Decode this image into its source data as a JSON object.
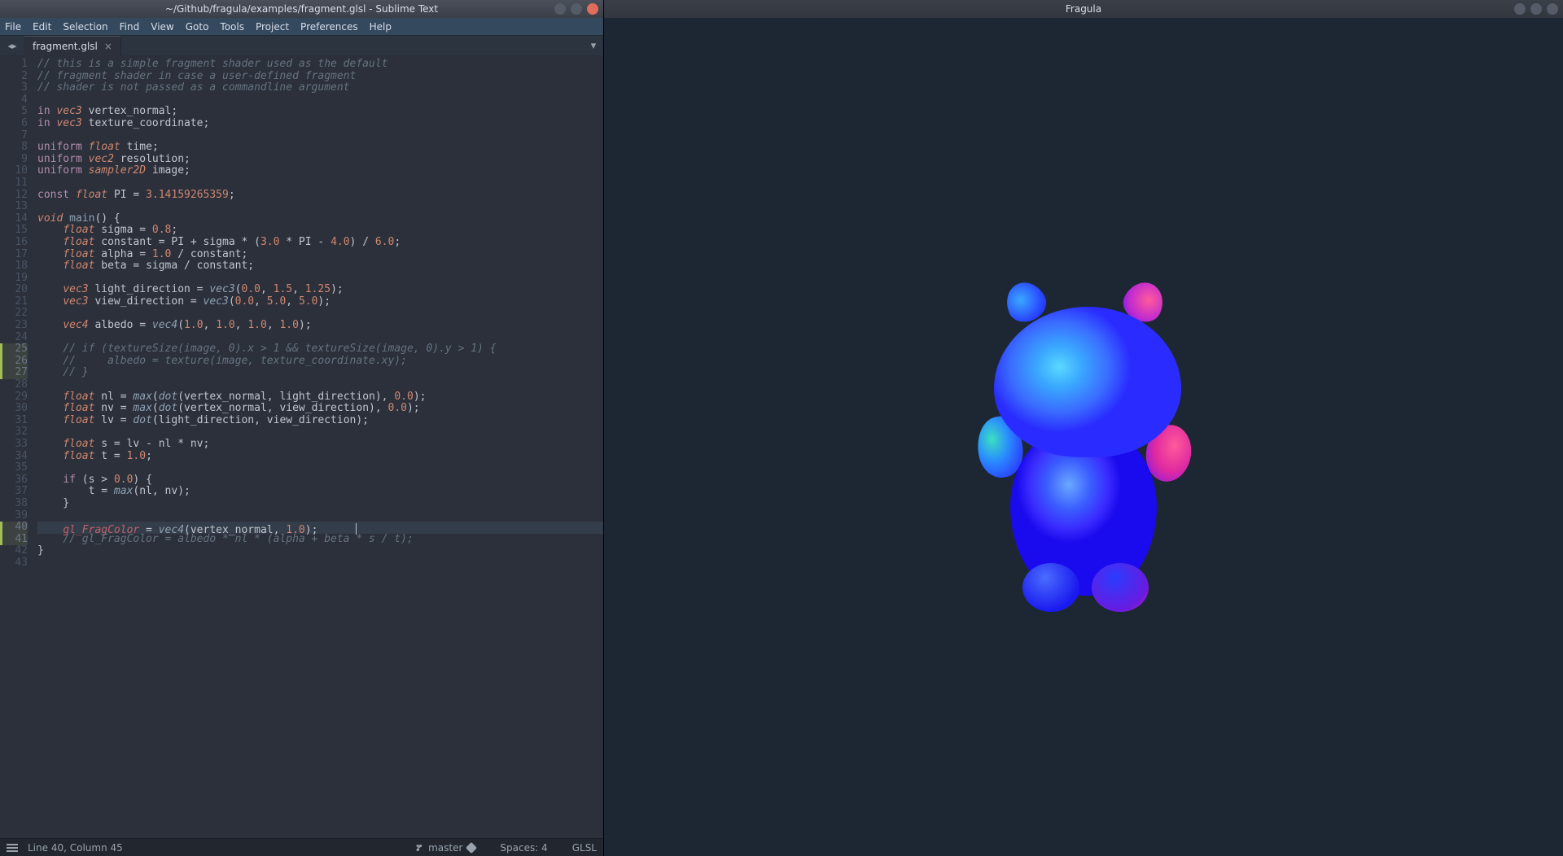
{
  "editor": {
    "title": "~/Github/fragula/examples/fragment.glsl - Sublime Text",
    "menu": [
      "File",
      "Edit",
      "Selection",
      "Find",
      "View",
      "Goto",
      "Tools",
      "Project",
      "Preferences",
      "Help"
    ],
    "tab_label": "fragment.glsl",
    "cursor_line": 40,
    "lines": [
      {
        "n": 1,
        "mod": false,
        "tokens": [
          [
            "c-comment",
            "// this is a simple fragment shader used as the default"
          ]
        ]
      },
      {
        "n": 2,
        "mod": false,
        "tokens": [
          [
            "c-comment",
            "// fragment shader in case a user-defined fragment"
          ]
        ]
      },
      {
        "n": 3,
        "mod": false,
        "tokens": [
          [
            "c-comment",
            "// shader is not passed as a commandline argument"
          ]
        ]
      },
      {
        "n": 4,
        "mod": false,
        "tokens": []
      },
      {
        "n": 5,
        "mod": false,
        "tokens": [
          [
            "c-kw",
            "in "
          ],
          [
            "c-type",
            "vec3 "
          ],
          [
            "c-ident",
            "vertex_normal;"
          ]
        ]
      },
      {
        "n": 6,
        "mod": false,
        "tokens": [
          [
            "c-kw",
            "in "
          ],
          [
            "c-type",
            "vec3 "
          ],
          [
            "c-ident",
            "texture_coordinate;"
          ]
        ]
      },
      {
        "n": 7,
        "mod": false,
        "tokens": []
      },
      {
        "n": 8,
        "mod": false,
        "tokens": [
          [
            "c-kw",
            "uniform "
          ],
          [
            "c-type",
            "float "
          ],
          [
            "c-ident",
            "time;"
          ]
        ]
      },
      {
        "n": 9,
        "mod": false,
        "tokens": [
          [
            "c-kw",
            "uniform "
          ],
          [
            "c-type",
            "vec2 "
          ],
          [
            "c-ident",
            "resolution;"
          ]
        ]
      },
      {
        "n": 10,
        "mod": false,
        "tokens": [
          [
            "c-kw",
            "uniform "
          ],
          [
            "c-type",
            "sampler2D "
          ],
          [
            "c-ident",
            "image;"
          ]
        ]
      },
      {
        "n": 11,
        "mod": false,
        "tokens": []
      },
      {
        "n": 12,
        "mod": false,
        "tokens": [
          [
            "c-kw",
            "const "
          ],
          [
            "c-type",
            "float "
          ],
          [
            "c-ident",
            "PI = "
          ],
          [
            "c-num",
            "3.14159265359"
          ],
          [
            "c-ident",
            ";"
          ]
        ]
      },
      {
        "n": 13,
        "mod": false,
        "tokens": []
      },
      {
        "n": 14,
        "mod": false,
        "tokens": [
          [
            "c-type",
            "void "
          ],
          [
            "c-func",
            "main"
          ],
          [
            "c-ident",
            "() {"
          ]
        ]
      },
      {
        "n": 15,
        "mod": false,
        "tokens": [
          [
            "c-ident",
            "    "
          ],
          [
            "c-type",
            "float "
          ],
          [
            "c-ident",
            "sigma = "
          ],
          [
            "c-num",
            "0.8"
          ],
          [
            "c-ident",
            ";"
          ]
        ]
      },
      {
        "n": 16,
        "mod": false,
        "tokens": [
          [
            "c-ident",
            "    "
          ],
          [
            "c-type",
            "float "
          ],
          [
            "c-ident",
            "constant = PI + sigma * ("
          ],
          [
            "c-num",
            "3.0"
          ],
          [
            "c-ident",
            " * PI - "
          ],
          [
            "c-num",
            "4.0"
          ],
          [
            "c-ident",
            ") / "
          ],
          [
            "c-num",
            "6.0"
          ],
          [
            "c-ident",
            ";"
          ]
        ]
      },
      {
        "n": 17,
        "mod": false,
        "tokens": [
          [
            "c-ident",
            "    "
          ],
          [
            "c-type",
            "float "
          ],
          [
            "c-ident",
            "alpha = "
          ],
          [
            "c-num",
            "1.0"
          ],
          [
            "c-ident",
            " / constant;"
          ]
        ]
      },
      {
        "n": 18,
        "mod": false,
        "tokens": [
          [
            "c-ident",
            "    "
          ],
          [
            "c-type",
            "float "
          ],
          [
            "c-ident",
            "beta = sigma / constant;"
          ]
        ]
      },
      {
        "n": 19,
        "mod": false,
        "tokens": []
      },
      {
        "n": 20,
        "mod": false,
        "tokens": [
          [
            "c-ident",
            "    "
          ],
          [
            "c-type",
            "vec3 "
          ],
          [
            "c-ident",
            "light_direction = "
          ],
          [
            "c-builtin",
            "vec3"
          ],
          [
            "c-ident",
            "("
          ],
          [
            "c-num",
            "0.0"
          ],
          [
            "c-ident",
            ", "
          ],
          [
            "c-num",
            "1.5"
          ],
          [
            "c-ident",
            ", "
          ],
          [
            "c-num",
            "1.25"
          ],
          [
            "c-ident",
            ");"
          ]
        ]
      },
      {
        "n": 21,
        "mod": false,
        "tokens": [
          [
            "c-ident",
            "    "
          ],
          [
            "c-type",
            "vec3 "
          ],
          [
            "c-ident",
            "view_direction = "
          ],
          [
            "c-builtin",
            "vec3"
          ],
          [
            "c-ident",
            "("
          ],
          [
            "c-num",
            "0.0"
          ],
          [
            "c-ident",
            ", "
          ],
          [
            "c-num",
            "5.0"
          ],
          [
            "c-ident",
            ", "
          ],
          [
            "c-num",
            "5.0"
          ],
          [
            "c-ident",
            ");"
          ]
        ]
      },
      {
        "n": 22,
        "mod": false,
        "tokens": []
      },
      {
        "n": 23,
        "mod": false,
        "tokens": [
          [
            "c-ident",
            "    "
          ],
          [
            "c-type",
            "vec4 "
          ],
          [
            "c-ident",
            "albedo = "
          ],
          [
            "c-builtin",
            "vec4"
          ],
          [
            "c-ident",
            "("
          ],
          [
            "c-num",
            "1.0"
          ],
          [
            "c-ident",
            ", "
          ],
          [
            "c-num",
            "1.0"
          ],
          [
            "c-ident",
            ", "
          ],
          [
            "c-num",
            "1.0"
          ],
          [
            "c-ident",
            ", "
          ],
          [
            "c-num",
            "1.0"
          ],
          [
            "c-ident",
            ");"
          ]
        ]
      },
      {
        "n": 24,
        "mod": false,
        "tokens": []
      },
      {
        "n": 25,
        "mod": true,
        "tokens": [
          [
            "c-ident",
            "    "
          ],
          [
            "c-comment",
            "// if (textureSize(image, 0).x > 1 && textureSize(image, 0).y > 1) {"
          ]
        ]
      },
      {
        "n": 26,
        "mod": true,
        "tokens": [
          [
            "c-ident",
            "    "
          ],
          [
            "c-comment",
            "//     albedo = texture(image, texture_coordinate.xy);"
          ]
        ]
      },
      {
        "n": 27,
        "mod": true,
        "tokens": [
          [
            "c-ident",
            "    "
          ],
          [
            "c-comment",
            "// }"
          ]
        ]
      },
      {
        "n": 28,
        "mod": false,
        "tokens": []
      },
      {
        "n": 29,
        "mod": false,
        "tokens": [
          [
            "c-ident",
            "    "
          ],
          [
            "c-type",
            "float "
          ],
          [
            "c-ident",
            "nl = "
          ],
          [
            "c-builtin",
            "max"
          ],
          [
            "c-ident",
            "("
          ],
          [
            "c-builtin",
            "dot"
          ],
          [
            "c-ident",
            "(vertex_normal, light_direction), "
          ],
          [
            "c-num",
            "0.0"
          ],
          [
            "c-ident",
            ");"
          ]
        ]
      },
      {
        "n": 30,
        "mod": false,
        "tokens": [
          [
            "c-ident",
            "    "
          ],
          [
            "c-type",
            "float "
          ],
          [
            "c-ident",
            "nv = "
          ],
          [
            "c-builtin",
            "max"
          ],
          [
            "c-ident",
            "("
          ],
          [
            "c-builtin",
            "dot"
          ],
          [
            "c-ident",
            "(vertex_normal, view_direction), "
          ],
          [
            "c-num",
            "0.0"
          ],
          [
            "c-ident",
            ");"
          ]
        ]
      },
      {
        "n": 31,
        "mod": false,
        "tokens": [
          [
            "c-ident",
            "    "
          ],
          [
            "c-type",
            "float "
          ],
          [
            "c-ident",
            "lv = "
          ],
          [
            "c-builtin",
            "dot"
          ],
          [
            "c-ident",
            "(light_direction, view_direction);"
          ]
        ]
      },
      {
        "n": 32,
        "mod": false,
        "tokens": []
      },
      {
        "n": 33,
        "mod": false,
        "tokens": [
          [
            "c-ident",
            "    "
          ],
          [
            "c-type",
            "float "
          ],
          [
            "c-ident",
            "s = lv - nl * nv;"
          ]
        ]
      },
      {
        "n": 34,
        "mod": false,
        "tokens": [
          [
            "c-ident",
            "    "
          ],
          [
            "c-type",
            "float "
          ],
          [
            "c-ident",
            "t = "
          ],
          [
            "c-num",
            "1.0"
          ],
          [
            "c-ident",
            ";"
          ]
        ]
      },
      {
        "n": 35,
        "mod": false,
        "tokens": []
      },
      {
        "n": 36,
        "mod": false,
        "tokens": [
          [
            "c-ident",
            "    "
          ],
          [
            "c-kw",
            "if"
          ],
          [
            "c-ident",
            " (s > "
          ],
          [
            "c-num",
            "0.0"
          ],
          [
            "c-ident",
            ") {"
          ]
        ]
      },
      {
        "n": 37,
        "mod": false,
        "tokens": [
          [
            "c-ident",
            "        t = "
          ],
          [
            "c-builtin",
            "max"
          ],
          [
            "c-ident",
            "(nl, nv);"
          ]
        ]
      },
      {
        "n": 38,
        "mod": false,
        "tokens": [
          [
            "c-ident",
            "    }"
          ]
        ]
      },
      {
        "n": 39,
        "mod": false,
        "tokens": []
      },
      {
        "n": 40,
        "mod": true,
        "tokens": [
          [
            "c-ident",
            "    "
          ],
          [
            "c-special",
            "gl_FragColor"
          ],
          [
            "c-ident",
            " = "
          ],
          [
            "c-builtin",
            "vec4"
          ],
          [
            "c-ident",
            "(vertex_normal, "
          ],
          [
            "c-num",
            "1.0"
          ],
          [
            "c-ident",
            ");"
          ]
        ]
      },
      {
        "n": 41,
        "mod": true,
        "tokens": [
          [
            "c-ident",
            "    "
          ],
          [
            "c-comment",
            "// gl_FragColor = albedo * nl * (alpha + beta * s / t);"
          ]
        ]
      },
      {
        "n": 42,
        "mod": false,
        "tokens": [
          [
            "c-ident",
            "}"
          ]
        ]
      },
      {
        "n": 43,
        "mod": false,
        "tokens": []
      }
    ],
    "status": {
      "position": "Line 40, Column 45",
      "branch": "master",
      "indent": "Spaces: 4",
      "syntax": "GLSL"
    }
  },
  "preview": {
    "title": "Fragula"
  }
}
